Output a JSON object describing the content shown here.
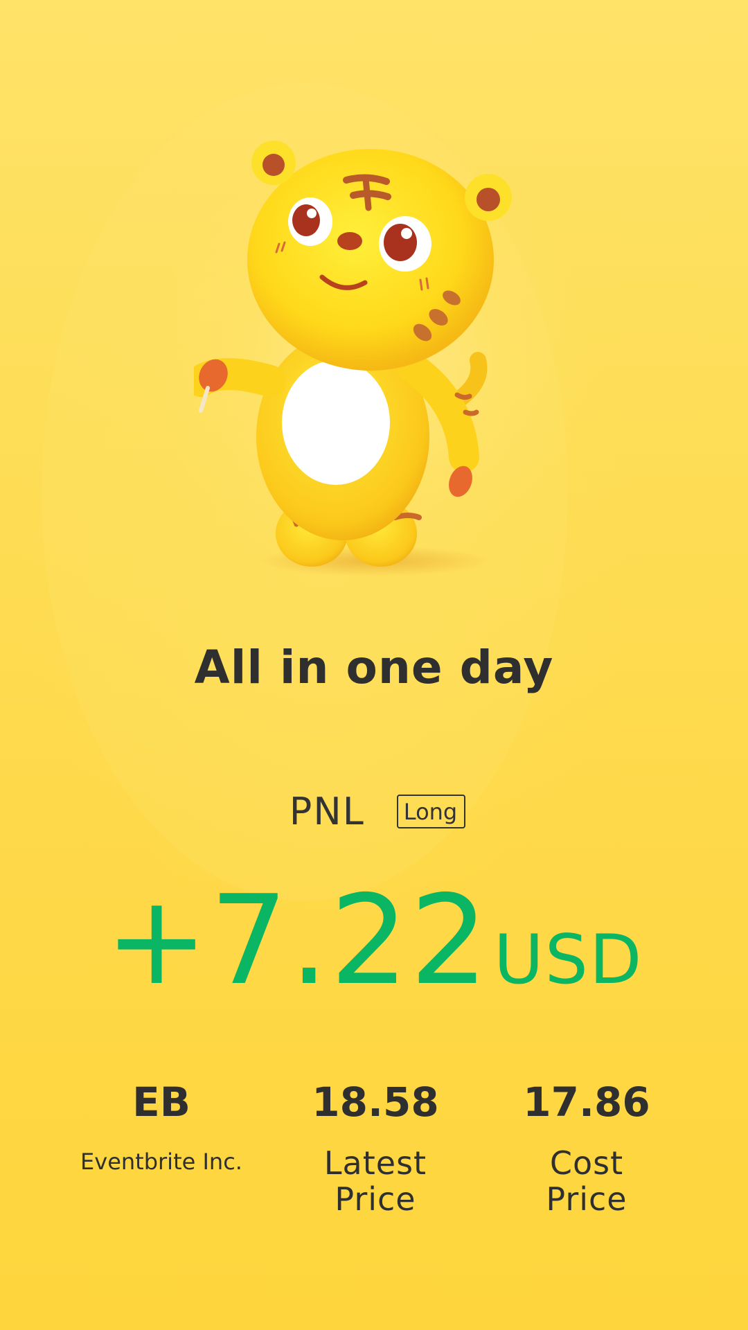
{
  "mascot": {
    "description_icon": "tiger-mascot-icon"
  },
  "headline": "All in one day",
  "pnl": {
    "label": "PNL",
    "position_badge": "Long"
  },
  "amount": {
    "value": "+7.22",
    "currency": "USD",
    "color": "#0ab563"
  },
  "stats": [
    {
      "value": "EB",
      "label": "Eventbrite Inc."
    },
    {
      "value": "18.58",
      "label_line1": "Latest",
      "label_line2": "Price"
    },
    {
      "value": "17.86",
      "label_line1": "Cost",
      "label_line2": "Price"
    }
  ],
  "colors": {
    "background": "#fdd63a",
    "text": "#2f2f2f",
    "positive": "#0ab563"
  }
}
